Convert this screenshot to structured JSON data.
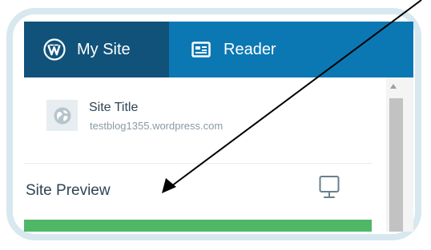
{
  "navigation": {
    "tabs": [
      {
        "label": "My Site",
        "icon": "wordpress-icon"
      },
      {
        "label": "Reader",
        "icon": "reader-icon"
      }
    ]
  },
  "site": {
    "title": "Site Title",
    "url": "testblog1355.wordpress.com",
    "icon": "globe-icon"
  },
  "preview": {
    "label": "Site Preview",
    "icon": "monitor-icon"
  },
  "colors": {
    "frame": "#d7e8ef",
    "my_site_tab": "#10527a",
    "reader_tab": "#0b78b4",
    "highlight": "#4fb766"
  }
}
